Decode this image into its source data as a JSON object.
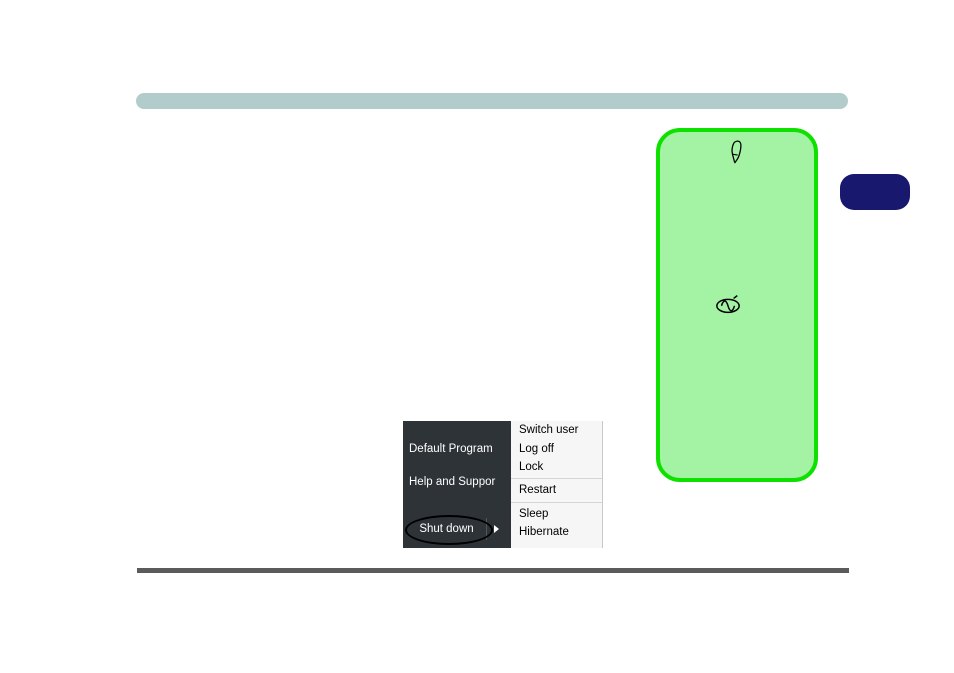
{
  "header": {
    "title": ""
  },
  "side_card": {
    "pen_icon": "pen-icon",
    "logo_icon": "logo-icon"
  },
  "nav_button": {
    "label": ""
  },
  "start_menu": {
    "left": {
      "default_programs": "Default Program",
      "help_and_support": "Help and Suppor",
      "shutdown_label": "Shut down"
    },
    "right": [
      "Switch user",
      "Log off",
      "Lock",
      "__divider__",
      "Restart",
      "__divider__",
      "Sleep",
      "Hibernate"
    ]
  }
}
